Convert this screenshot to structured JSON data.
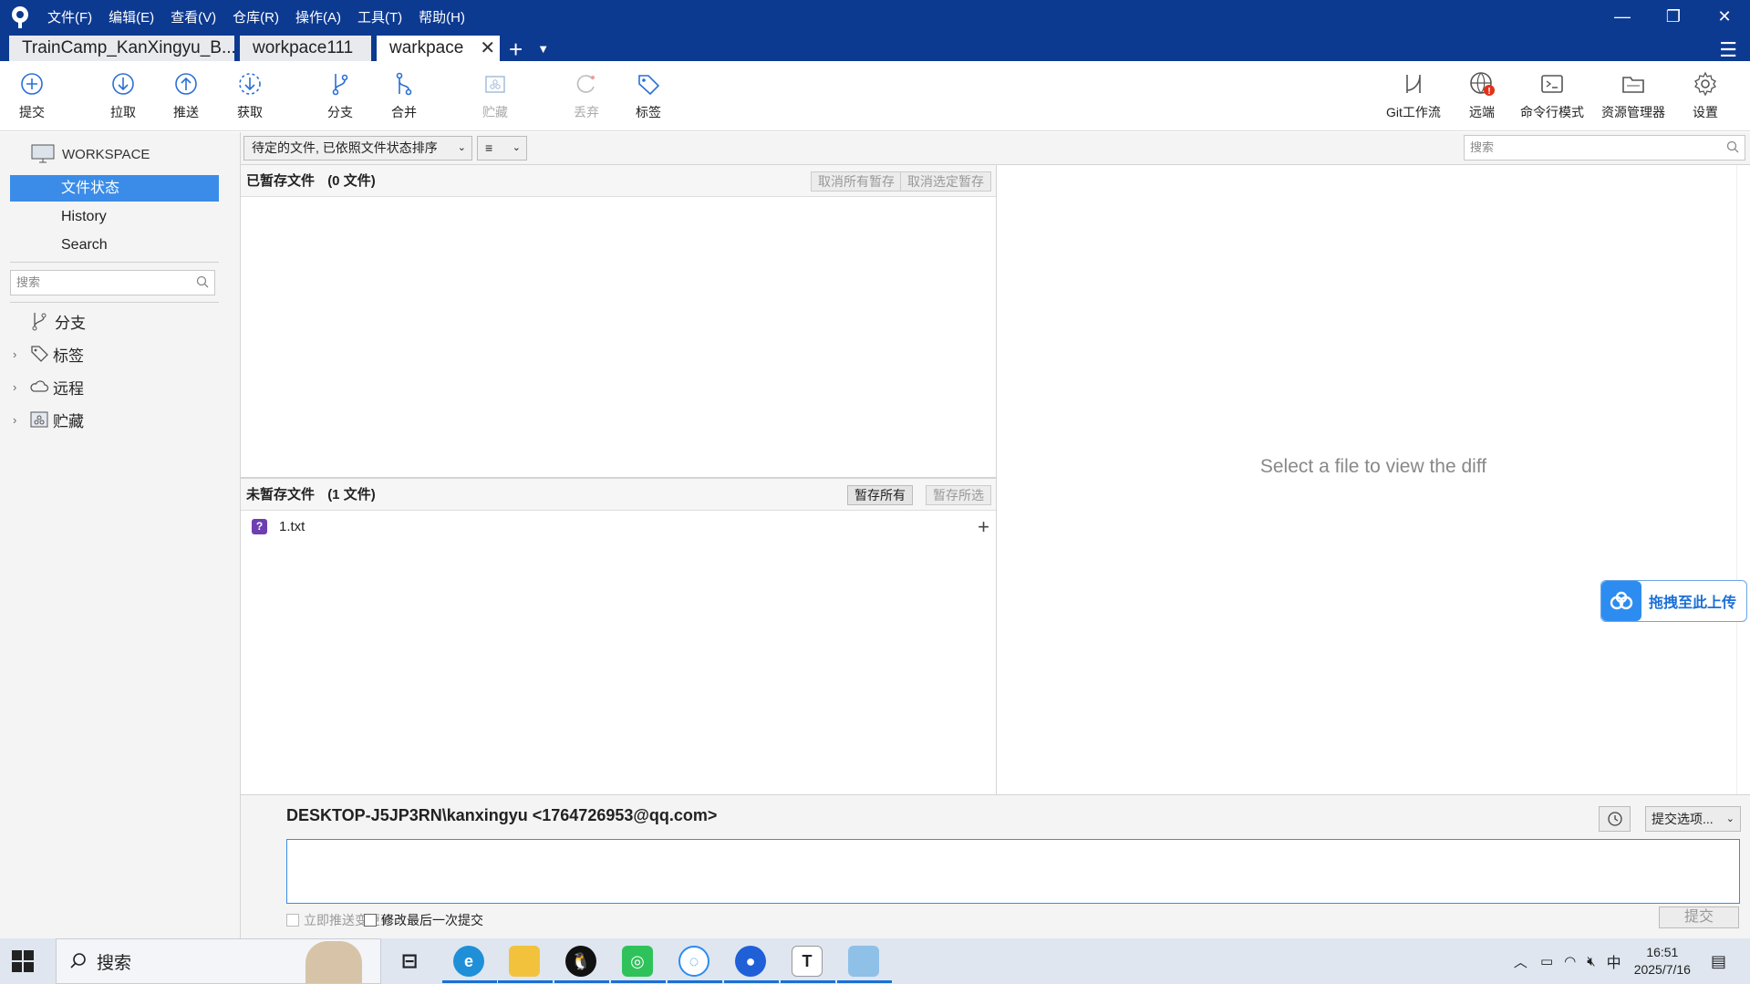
{
  "menu": [
    "文件(F)",
    "编辑(E)",
    "查看(V)",
    "仓库(R)",
    "操作(A)",
    "工具(T)",
    "帮助(H)"
  ],
  "tabs": [
    {
      "label": "TrainCamp_KanXingyu_B..."
    },
    {
      "label": "workpace111"
    },
    {
      "label": "warkpace"
    }
  ],
  "toolbar": {
    "commit": "提交",
    "pull": "拉取",
    "push": "推送",
    "fetch": "获取",
    "branch": "分支",
    "merge": "合并",
    "stash": "贮藏",
    "discard": "丢弃",
    "tag": "标签",
    "gitflow": "Git工作流",
    "remote": "远端",
    "terminal": "命令行模式",
    "explorer": "资源管理器",
    "settings": "设置"
  },
  "sidebar": {
    "workspace": "WORKSPACE",
    "items": [
      "文件状态",
      "History",
      "Search"
    ],
    "search_placeholder": "搜索",
    "tree": [
      "分支",
      "标签",
      "远程",
      "贮藏"
    ]
  },
  "filter": {
    "sort_label": "待定的文件, 已依照文件状态排序",
    "view_label": "≡",
    "search_placeholder": "搜索"
  },
  "staged": {
    "title": "已暂存文件",
    "count": "(0 文件)",
    "unstage_all": "取消所有暂存",
    "unstage_selected": "取消选定暂存"
  },
  "unstaged": {
    "title": "未暂存文件",
    "count": "(1 文件)",
    "stage_all": "暂存所有",
    "stage_selected": "暂存所选",
    "files": [
      {
        "name": "1.txt",
        "status": "?"
      }
    ]
  },
  "diff": {
    "empty": "Select a file to view the diff"
  },
  "upload_badge": "拖拽至此上传",
  "commit": {
    "author": "DESKTOP-J5JP3RN\\kanxingyu <1764726953@qq.com>",
    "options": "提交选项...",
    "push_now": "立即推送变更到 -",
    "amend": "修改最后一次提交",
    "button": "提交"
  },
  "taskbar": {
    "search": "搜索",
    "ime": "中",
    "time": "16:51",
    "date": "2025/7/16"
  },
  "colors": {
    "titlebar": "#0d3a91",
    "accent": "#3a8ce8",
    "untracked": "#6d3fb0",
    "badge_alert": "#e0321b"
  }
}
